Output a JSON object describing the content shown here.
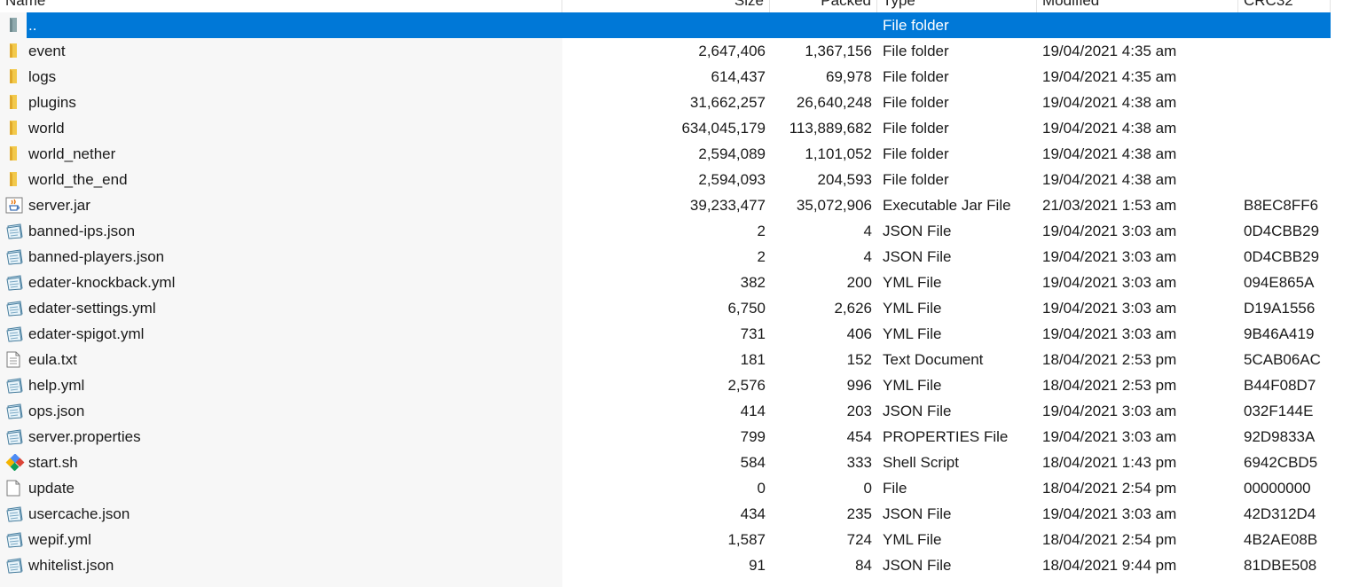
{
  "columns": {
    "name": "Name",
    "size": "Size",
    "packed": "Packed",
    "type": "Type",
    "modified": "Modified",
    "crc": "CRC32"
  },
  "rows": [
    {
      "icon": "parent-folder-icon",
      "name": "..",
      "size": "",
      "packed": "",
      "type": "File folder",
      "modified": "",
      "crc": "",
      "selected": true
    },
    {
      "icon": "folder-icon",
      "name": "event",
      "size": "2,647,406",
      "packed": "1,367,156",
      "type": "File folder",
      "modified": "19/04/2021 4:35 am",
      "crc": ""
    },
    {
      "icon": "folder-icon",
      "name": "logs",
      "size": "614,437",
      "packed": "69,978",
      "type": "File folder",
      "modified": "19/04/2021 4:35 am",
      "crc": ""
    },
    {
      "icon": "folder-icon",
      "name": "plugins",
      "size": "31,662,257",
      "packed": "26,640,248",
      "type": "File folder",
      "modified": "19/04/2021 4:38 am",
      "crc": ""
    },
    {
      "icon": "folder-icon",
      "name": "world",
      "size": "634,045,179",
      "packed": "113,889,682",
      "type": "File folder",
      "modified": "19/04/2021 4:38 am",
      "crc": ""
    },
    {
      "icon": "folder-icon",
      "name": "world_nether",
      "size": "2,594,089",
      "packed": "1,101,052",
      "type": "File folder",
      "modified": "19/04/2021 4:38 am",
      "crc": ""
    },
    {
      "icon": "folder-icon",
      "name": "world_the_end",
      "size": "2,594,093",
      "packed": "204,593",
      "type": "File folder",
      "modified": "19/04/2021 4:38 am",
      "crc": ""
    },
    {
      "icon": "java-jar-icon",
      "name": "server.jar",
      "size": "39,233,477",
      "packed": "35,072,906",
      "type": "Executable Jar File",
      "modified": "21/03/2021 1:53 am",
      "crc": "B8EC8FF6"
    },
    {
      "icon": "config-file-icon",
      "name": "banned-ips.json",
      "size": "2",
      "packed": "4",
      "type": "JSON File",
      "modified": "19/04/2021 3:03 am",
      "crc": "0D4CBB29"
    },
    {
      "icon": "config-file-icon",
      "name": "banned-players.json",
      "size": "2",
      "packed": "4",
      "type": "JSON File",
      "modified": "19/04/2021 3:03 am",
      "crc": "0D4CBB29"
    },
    {
      "icon": "config-file-icon",
      "name": "edater-knockback.yml",
      "size": "382",
      "packed": "200",
      "type": "YML File",
      "modified": "19/04/2021 3:03 am",
      "crc": "094E865A"
    },
    {
      "icon": "config-file-icon",
      "name": "edater-settings.yml",
      "size": "6,750",
      "packed": "2,626",
      "type": "YML File",
      "modified": "19/04/2021 3:03 am",
      "crc": "D19A1556"
    },
    {
      "icon": "config-file-icon",
      "name": "edater-spigot.yml",
      "size": "731",
      "packed": "406",
      "type": "YML File",
      "modified": "19/04/2021 3:03 am",
      "crc": "9B46A419"
    },
    {
      "icon": "text-document-icon",
      "name": "eula.txt",
      "size": "181",
      "packed": "152",
      "type": "Text Document",
      "modified": "18/04/2021 2:53 pm",
      "crc": "5CAB06AC"
    },
    {
      "icon": "config-file-icon",
      "name": "help.yml",
      "size": "2,576",
      "packed": "996",
      "type": "YML File",
      "modified": "18/04/2021 2:53 pm",
      "crc": "B44F08D7"
    },
    {
      "icon": "config-file-icon",
      "name": "ops.json",
      "size": "414",
      "packed": "203",
      "type": "JSON File",
      "modified": "19/04/2021 3:03 am",
      "crc": "032F144E"
    },
    {
      "icon": "config-file-icon",
      "name": "server.properties",
      "size": "799",
      "packed": "454",
      "type": "PROPERTIES File",
      "modified": "19/04/2021 3:03 am",
      "crc": "92D9833A"
    },
    {
      "icon": "shell-script-icon",
      "name": "start.sh",
      "size": "584",
      "packed": "333",
      "type": "Shell Script",
      "modified": "18/04/2021 1:43 pm",
      "crc": "6942CBD5"
    },
    {
      "icon": "blank-file-icon",
      "name": "update",
      "size": "0",
      "packed": "0",
      "type": "File",
      "modified": "18/04/2021 2:54 pm",
      "crc": "00000000"
    },
    {
      "icon": "config-file-icon",
      "name": "usercache.json",
      "size": "434",
      "packed": "235",
      "type": "JSON File",
      "modified": "19/04/2021 3:03 am",
      "crc": "42D312D4"
    },
    {
      "icon": "config-file-icon",
      "name": "wepif.yml",
      "size": "1,587",
      "packed": "724",
      "type": "YML File",
      "modified": "18/04/2021 2:54 pm",
      "crc": "4B2AE08B"
    },
    {
      "icon": "config-file-icon",
      "name": "whitelist.json",
      "size": "91",
      "packed": "84",
      "type": "JSON File",
      "modified": "18/04/2021 9:44 pm",
      "crc": "81DBE508"
    }
  ],
  "colors": {
    "selection": "#0078d7",
    "folder": "#f2c94c",
    "name_column_bg": "#f7f7f7"
  }
}
